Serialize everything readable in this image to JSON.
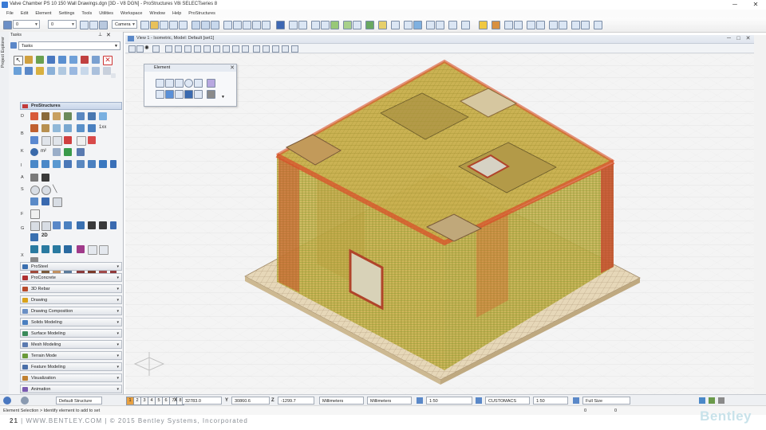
{
  "window": {
    "title": "Valve Chamber PS 10 150 Wall Drawings.dgn [3D - V8 DGN] - ProStructures V8i SELECTseries 8",
    "minimize": "─",
    "close": "✕"
  },
  "menu": [
    "File",
    "Edit",
    "Element",
    "Settings",
    "Tools",
    "Utilities",
    "Workspace",
    "Window",
    "Help",
    "ProStructures"
  ],
  "toolbar": {
    "level_combo": "0",
    "by_level_combo": "0",
    "camera_combo": "Camera"
  },
  "side_tab": {
    "label": "Project Explorer"
  },
  "tasks": {
    "header": "Tasks",
    "selector": "Tasks",
    "prostructures_label": "ProStructures",
    "rows_letters": [
      "D",
      "B",
      "K",
      "I",
      "A",
      "S",
      "F",
      "G",
      "X"
    ],
    "text_icon_1": "1xx",
    "text_icon_2": "2D",
    "sections": [
      {
        "label": "ProSteel",
        "color": "#3a6fb0"
      },
      {
        "label": "ProConcrete",
        "color": "#b03030"
      },
      {
        "label": "3D Rebar",
        "color": "#b84a2a"
      },
      {
        "label": "Drawing",
        "color": "#d9a21a"
      },
      {
        "label": "Drawing Composition",
        "color": "#6a8fc4"
      },
      {
        "label": "Solids Modeling",
        "color": "#4a7fc0"
      },
      {
        "label": "Surface Modeling",
        "color": "#3a8a5a"
      },
      {
        "label": "Mesh Modeling",
        "color": "#5a7ab0"
      },
      {
        "label": "Terrain Mode",
        "color": "#6a9a3a"
      },
      {
        "label": "Feature Modeling",
        "color": "#4a6fa8"
      },
      {
        "label": "Visualization",
        "color": "#c08030"
      },
      {
        "label": "Animation",
        "color": "#7a5ab0"
      }
    ]
  },
  "view": {
    "title": "View 1 - Isometric, Model: Default [set1]",
    "minimize": "─",
    "maximize": "□",
    "close": "✕"
  },
  "element_palette": {
    "title": "Element",
    "close": "✕",
    "dropdown": "▼"
  },
  "status": {
    "views": [
      "1",
      "2",
      "3",
      "4",
      "5",
      "6",
      "7",
      "8"
    ],
    "default_structure": "Default Structure",
    "x_label": "X",
    "x_value": "32783.0",
    "y_label": "Y",
    "y_value": "30860.6",
    "z_label": "Z",
    "z_value": "-1299.7",
    "unit1": "Millimeters",
    "unit2": "Millimeters",
    "scale1": "1:50",
    "customacs": "CUSTOMACS",
    "scale2": "1:50",
    "full_size": "Full Size",
    "zero1": "0",
    "zero2": "0"
  },
  "message": "Element Selection > Identify element to add to set",
  "footer": {
    "page": "21",
    "website": "WWW.BENTLEY.COM",
    "copyright": "© 2015 Bentley Systems, Incorporated",
    "logo": "Bentley"
  },
  "colors": {
    "rebar_red": "#c2482a",
    "rebar_green": "#6a9a32",
    "rebar_olive": "#b8a23c",
    "slab_tan": "#d9c8a6"
  }
}
